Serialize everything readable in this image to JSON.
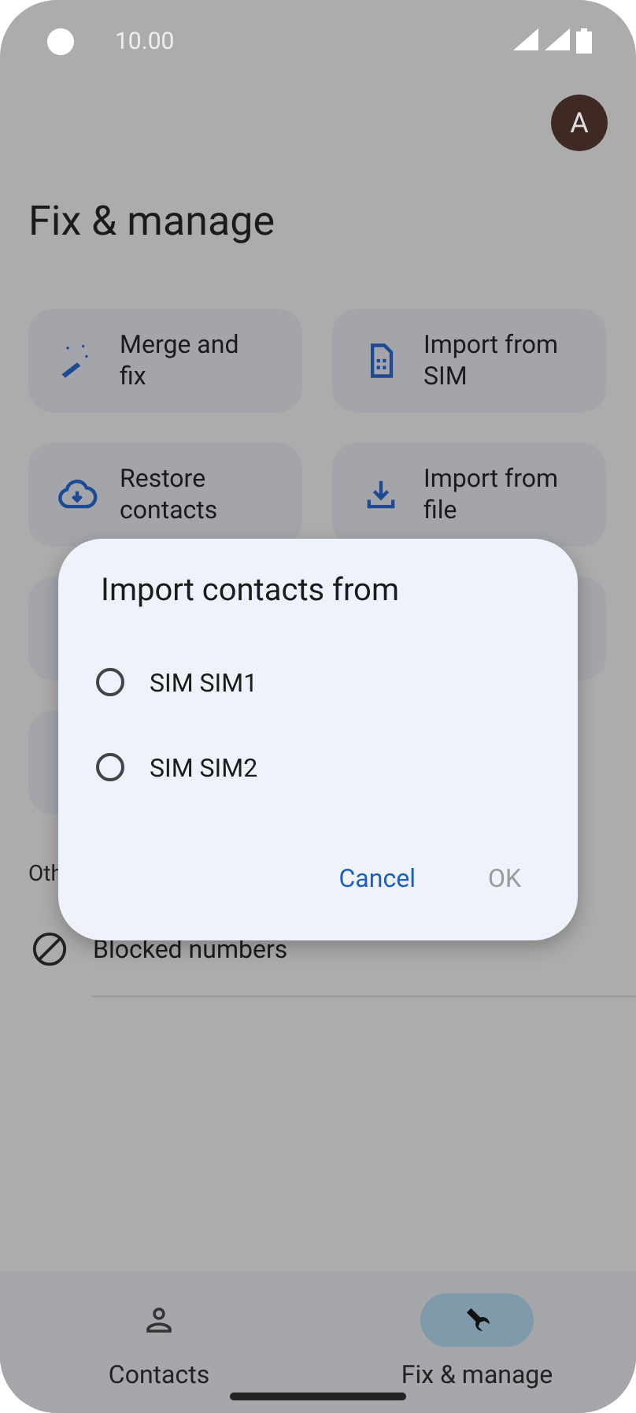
{
  "status_bar": {
    "time": "10.00"
  },
  "header": {
    "avatar": "A",
    "title": "Fix & manage"
  },
  "cards": [
    {
      "label": "Merge and fix",
      "kind": "wand"
    },
    {
      "label": "Import from SIM",
      "kind": "sim"
    },
    {
      "label": "Restore contacts",
      "kind": "cloud"
    },
    {
      "label": "Import from file",
      "kind": "download"
    }
  ],
  "section_label": "Oth",
  "list": [
    {
      "label": "Blocked numbers"
    }
  ],
  "dialog": {
    "title": "Import contacts from",
    "options": [
      {
        "label": "SIM SIM1",
        "selected": false
      },
      {
        "label": "SIM SIM2",
        "selected": false
      }
    ],
    "buttons": [
      {
        "label": "Cancel",
        "disabled": false
      },
      {
        "label": "OK",
        "disabled": true
      }
    ]
  },
  "nav": [
    {
      "label": "Contacts",
      "kind": "person",
      "selected": false
    },
    {
      "label": "Fix & manage",
      "kind": "wrench",
      "selected": true
    }
  ]
}
